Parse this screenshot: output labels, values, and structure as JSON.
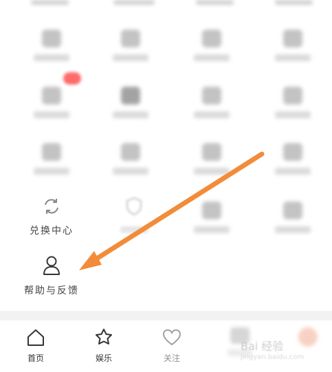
{
  "grid": {
    "exchange_center_label": "兑换中心",
    "help_feedback_label": "帮助与反馈"
  },
  "bottom_nav": {
    "items": [
      {
        "label": "首页",
        "icon": "home-icon"
      },
      {
        "label": "娱乐",
        "icon": "star-icon"
      },
      {
        "label": "关注",
        "icon": "heart-icon"
      }
    ]
  },
  "watermark": {
    "text": "Bai 经验",
    "sub": "jingyan.baidu.com"
  },
  "colors": {
    "arrow": "#f28c3a",
    "badge": "#ff6b6b",
    "separator": "#f2f2f2"
  }
}
